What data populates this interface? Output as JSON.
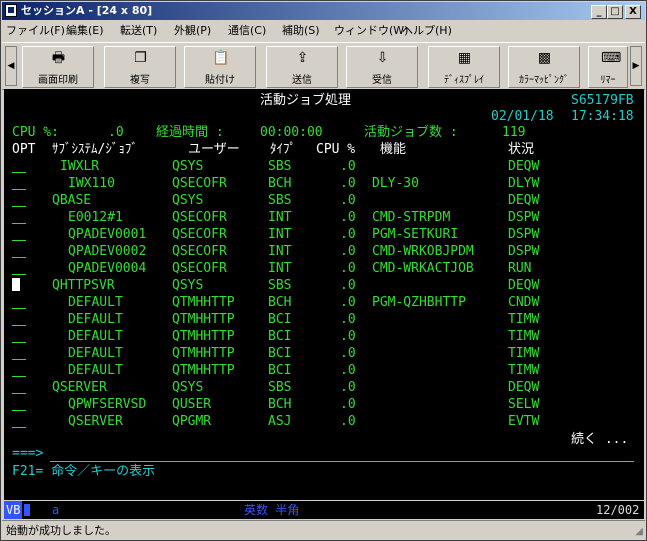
{
  "window": {
    "title": "セッションA - [24 x 80]",
    "min_btn": "_",
    "max_btn": "□",
    "close_btn": "X"
  },
  "menu": [
    "ファイル(F)",
    "編集(E)",
    "転送(T)",
    "外観(P)",
    "通信(C)",
    "補助(S)",
    "ウィンドウ(W)",
    "ヘルプ(H)"
  ],
  "toolbar": {
    "buttons": [
      {
        "label": "画面印刷",
        "icon": "printer-icon"
      },
      {
        "label": "複写",
        "icon": "copy-icon"
      },
      {
        "label": "貼付け",
        "icon": "paste-icon"
      },
      {
        "label": "送信",
        "icon": "send-icon"
      },
      {
        "label": "受信",
        "icon": "receive-icon"
      },
      {
        "label": "ﾃﾞｨｽﾌﾟﾚｲ",
        "icon": "display-icon"
      },
      {
        "label": "ｶﾗｰﾏｯﾋﾟﾝｸﾞ",
        "icon": "color-mapping-icon"
      },
      {
        "label": "ﾘﾏｰ",
        "icon": "remap-icon"
      }
    ]
  },
  "screen": {
    "title": "活動ジョブ処理",
    "system": "S65179FB",
    "date": "02/01/18",
    "time": "17:34:18",
    "cpu_label": "CPU %:",
    "cpu_value": ".0",
    "elapsed_label": "経過時間 :",
    "elapsed_value": "00:00:00",
    "jobs_label": "活動ジョブ数 :",
    "jobs_value": "119",
    "headers": {
      "opt": "OPT",
      "sub": "ｻﾌﾞｼｽﾃﾑ/ｼﾞｮﾌﾞ",
      "user": "ユーザー",
      "type": "ﾀｲﾌﾟ",
      "cpu": "CPU %",
      "func": "機能",
      "status": "状況"
    },
    "rows": [
      {
        "job": "IWXLR",
        "user": "QSYS",
        "type": "SBS",
        "cpu": ".0",
        "func": "",
        "status": "DEQW"
      },
      {
        "job": "IWX110",
        "user": "QSECOFR",
        "type": "BCH",
        "cpu": ".0",
        "func": "DLY-30",
        "status": "DLYW"
      },
      {
        "job": "QBASE",
        "user": "QSYS",
        "type": "SBS",
        "cpu": ".0",
        "func": "",
        "status": "DEQW"
      },
      {
        "job": "E0012#1",
        "user": "QSECOFR",
        "type": "INT",
        "cpu": ".0",
        "func": "CMD-STRPDM",
        "status": "DSPW"
      },
      {
        "job": "QPADEV0001",
        "user": "QSECOFR",
        "type": "INT",
        "cpu": ".0",
        "func": "PGM-SETKURI",
        "status": "DSPW"
      },
      {
        "job": "QPADEV0002",
        "user": "QSECOFR",
        "type": "INT",
        "cpu": ".0",
        "func": "CMD-WRKOBJPDM",
        "status": "DSPW"
      },
      {
        "job": "QPADEV0004",
        "user": "QSECOFR",
        "type": "INT",
        "cpu": ".0",
        "func": "CMD-WRKACTJOB",
        "status": "RUN"
      },
      {
        "job": "QHTTPSVR",
        "user": "QSYS",
        "type": "SBS",
        "cpu": ".0",
        "func": "",
        "status": "DEQW"
      },
      {
        "job": "DEFAULT",
        "user": "QTMHHTTP",
        "type": "BCH",
        "cpu": ".0",
        "func": "PGM-QZHBHTTP",
        "status": "CNDW"
      },
      {
        "job": "DEFAULT",
        "user": "QTMHHTTP",
        "type": "BCI",
        "cpu": ".0",
        "func": "",
        "status": "TIMW"
      },
      {
        "job": "DEFAULT",
        "user": "QTMHHTTP",
        "type": "BCI",
        "cpu": ".0",
        "func": "",
        "status": "TIMW"
      },
      {
        "job": "DEFAULT",
        "user": "QTMHHTTP",
        "type": "BCI",
        "cpu": ".0",
        "func": "",
        "status": "TIMW"
      },
      {
        "job": "DEFAULT",
        "user": "QTMHHTTP",
        "type": "BCI",
        "cpu": ".0",
        "func": "",
        "status": "TIMW"
      },
      {
        "job": "QSERVER",
        "user": "QSYS",
        "type": "SBS",
        "cpu": ".0",
        "func": "",
        "status": "DEQW"
      },
      {
        "job": "QPWFSERVSD",
        "user": "QUSER",
        "type": "BCH",
        "cpu": ".0",
        "func": "",
        "status": "SELW"
      },
      {
        "job": "QSERVER",
        "user": "QPGMR",
        "type": "ASJ",
        "cpu": ".0",
        "func": "",
        "status": "EVTW"
      }
    ],
    "more": "続く ...",
    "prompt": "===>",
    "fkeys": "F21= 命令／キーの表示"
  },
  "oia": {
    "left": "VB",
    "mode": "a",
    "ime": "英数 半角",
    "position": "12/002"
  },
  "status": {
    "message": "始動が成功しました。"
  }
}
